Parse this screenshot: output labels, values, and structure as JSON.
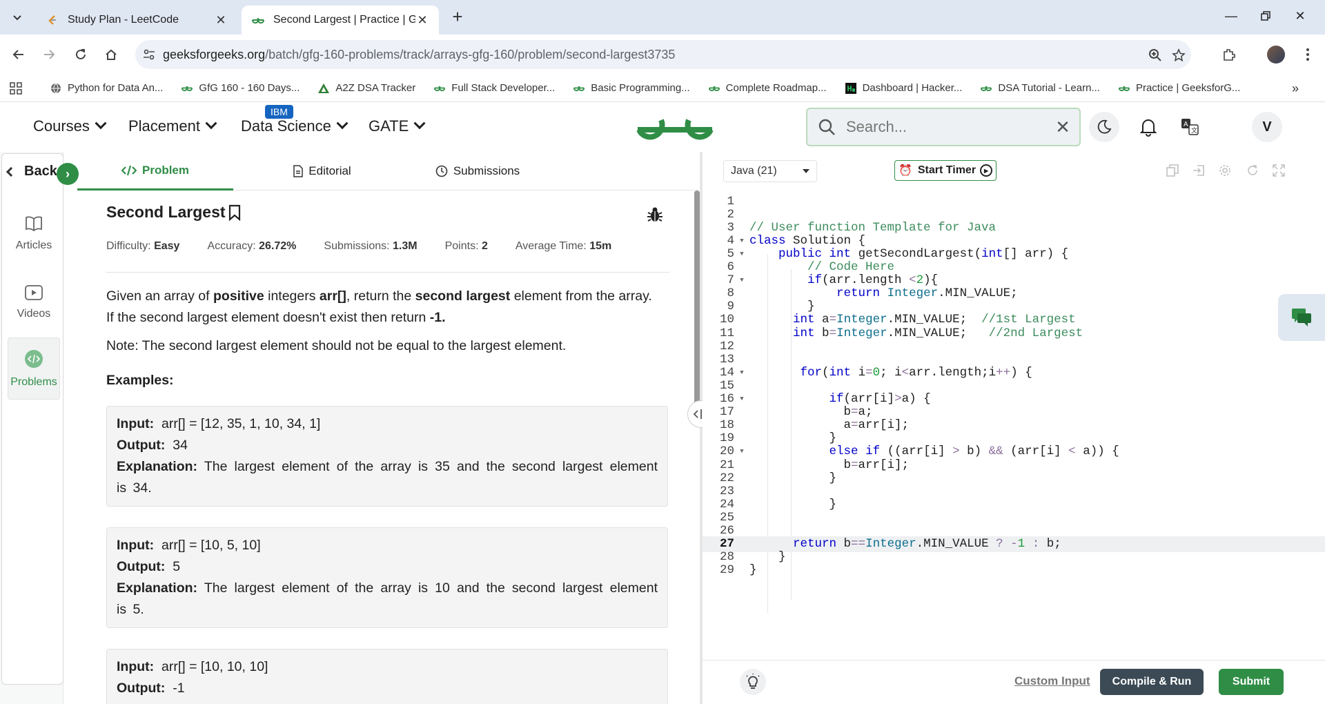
{
  "browser": {
    "tabs": [
      {
        "title": "Study Plan - LeetCode",
        "active": false
      },
      {
        "title": "Second Largest | Practice | Geek",
        "active": true
      }
    ],
    "url_host": "geeksforgeeks.org",
    "url_path": "/batch/gfg-160-problems/track/arrays-gfg-160/problem/second-largest3735",
    "bookmarks": [
      {
        "label": "Python for Data An...",
        "icon": "globe-icon"
      },
      {
        "label": "GfG 160 - 160 Days...",
        "icon": "gfg-icon"
      },
      {
        "label": "A2Z DSA Tracker",
        "icon": "a2z-icon"
      },
      {
        "label": "Full Stack Developer...",
        "icon": "gfg-icon"
      },
      {
        "label": "Basic Programming...",
        "icon": "gfg-icon"
      },
      {
        "label": "Complete Roadmap...",
        "icon": "gfg-icon"
      },
      {
        "label": "Dashboard | Hacker...",
        "icon": "hackerrank-icon"
      },
      {
        "label": "DSA Tutorial - Learn...",
        "icon": "gfg-icon"
      },
      {
        "label": "Practice | GeeksforG...",
        "icon": "gfg-icon"
      }
    ]
  },
  "header": {
    "nav": [
      "Courses",
      "Placement",
      "Data Science",
      "GATE"
    ],
    "ibm_badge": "IBM",
    "search_placeholder": "Search...",
    "user_initial": "V"
  },
  "rail": {
    "back": "Back",
    "items": [
      {
        "label": "Articles",
        "icon": "book-icon"
      },
      {
        "label": "Videos",
        "icon": "video-icon"
      },
      {
        "label": "Problems",
        "icon": "code-icon",
        "active": true
      }
    ]
  },
  "problem": {
    "tabs": [
      "Problem",
      "Editorial",
      "Submissions"
    ],
    "title": "Second Largest",
    "meta": {
      "difficulty_label": "Difficulty:",
      "difficulty": "Easy",
      "accuracy_label": "Accuracy:",
      "accuracy": "26.72%",
      "submissions_label": "Submissions:",
      "submissions": "1.3M",
      "points_label": "Points:",
      "points": "2",
      "avg_time_label": "Average Time:",
      "avg_time": "15m"
    },
    "desc": {
      "p1": "Given an array of ",
      "b1": "positive",
      "p2": " integers ",
      "b2": "arr[]",
      "p3": ", return the ",
      "b3": "second largest",
      "p4": " element from the array. If the second largest element doesn't exist then return ",
      "b4": "-1."
    },
    "note": "Note: The second largest element should not be equal to the largest element.",
    "examples_heading": "Examples:",
    "examples": [
      {
        "input_label": "Input:",
        "input": "arr[] = [12, 35, 1, 10, 34, 1]",
        "output_label": "Output:",
        "output": "34",
        "expl_label": "Explanation:",
        "expl": "The largest element of the array is 35 and the second largest element is 34."
      },
      {
        "input_label": "Input:",
        "input": "arr[] = [10, 5, 10]",
        "output_label": "Output:",
        "output": "5",
        "expl_label": "Explanation:",
        "expl": "The largest element of the array is 10 and the second largest element is 5."
      },
      {
        "input_label": "Input:",
        "input": "arr[] = [10, 10, 10]",
        "output_label": "Output:",
        "output": "-1"
      }
    ]
  },
  "editor": {
    "language": "Java (21)",
    "start_timer": "Start Timer",
    "current_line": 27,
    "lines": [
      "",
      "",
      "// User function Template for Java",
      "class Solution {",
      "    public int getSecondLargest(int[] arr) {",
      "        // Code Here",
      "        if(arr.length <2){",
      "            return Integer.MIN_VALUE;",
      "        }",
      "      int a=Integer.MIN_VALUE;  //1st Largest",
      "      int b=Integer.MIN_VALUE;   //2nd Largest",
      "",
      "",
      "       for(int i=0; i<arr.length;i++) {",
      "",
      "           if(arr[i]>a) {",
      "             b=a;",
      "             a=arr[i];",
      "           }",
      "           else if ((arr[i] > b) && (arr[i] < a)) {",
      "             b=arr[i];",
      "           }",
      "",
      "           }",
      "",
      "",
      "      return b==Integer.MIN_VALUE ? -1 : b;",
      "    }",
      "}"
    ],
    "folded_lines": [
      4,
      5,
      7,
      14,
      16,
      20
    ],
    "custom_input": "Custom Input",
    "compile_run": "Compile & Run",
    "submit": "Submit"
  }
}
